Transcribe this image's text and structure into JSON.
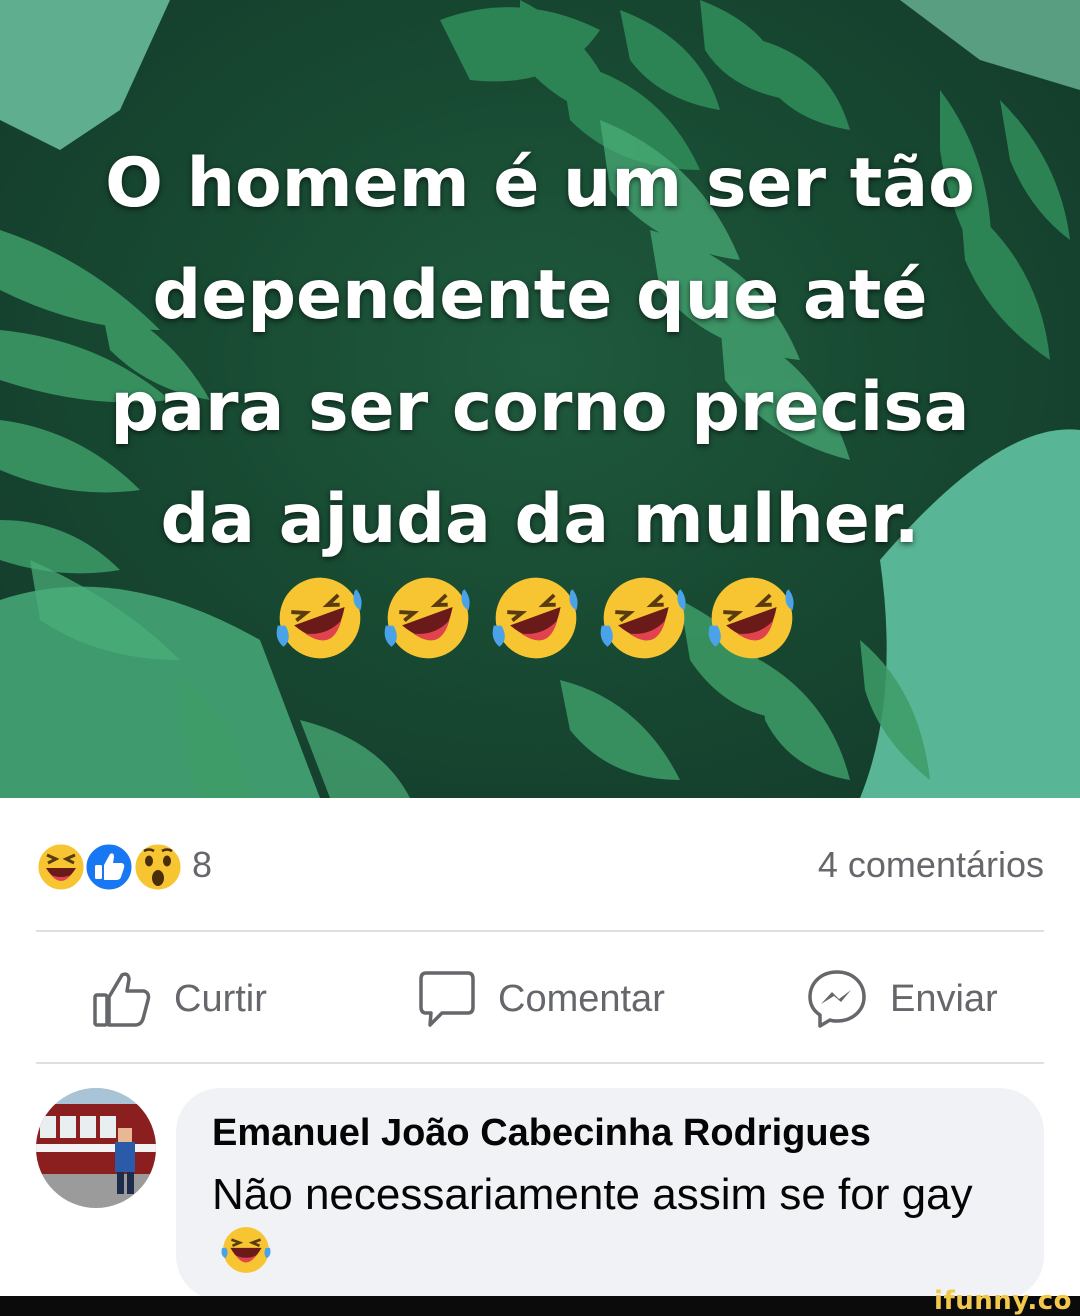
{
  "post": {
    "image_text_lines": [
      "O homem é um ser tão",
      "dependente que até",
      "para ser corno precisa",
      "da ajuda da mulher."
    ],
    "image_emoji": [
      "laughing-crying-emoji",
      "laughing-crying-emoji",
      "laughing-crying-emoji",
      "laughing-crying-emoji",
      "laughing-crying-emoji"
    ]
  },
  "reactions": {
    "icons": [
      "haha-reaction",
      "like-reaction",
      "wow-reaction"
    ],
    "count": "8",
    "comments_label": "4 comentários"
  },
  "actions": {
    "like_label": "Curtir",
    "comment_label": "Comentar",
    "send_label": "Enviar"
  },
  "comment": {
    "author": "Emanuel João Cabecinha Rodrigues",
    "text": "Não necessariamente assim se for gay",
    "emoji": "laughing-crying-emoji"
  },
  "watermark": "ifunny.co",
  "colors": {
    "secondary_text": "#65676b",
    "bubble_bg": "#f0f2f5",
    "like_blue": "#1877f2",
    "leaf_green": "#2e8b57"
  }
}
